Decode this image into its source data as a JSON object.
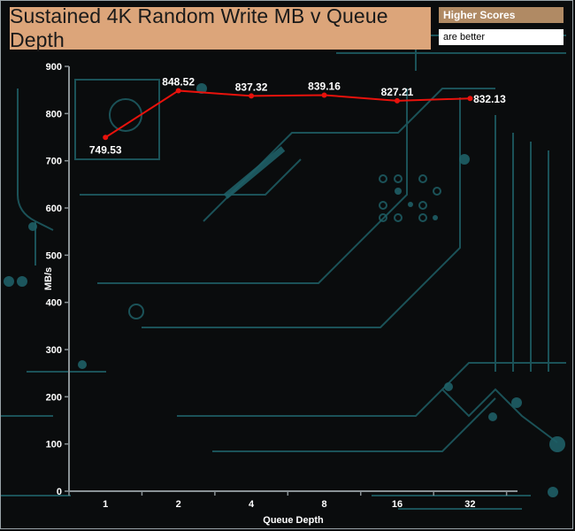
{
  "title": "Sustained 4K Random Write MB v Queue Depth",
  "legend": {
    "line1": "Higher Scores",
    "line2": "are better"
  },
  "colors": {
    "title_bg": "#dca57a",
    "series_line": "#e8120c",
    "circuit": "#1e5f66"
  },
  "chart_data": {
    "type": "line",
    "title": "Sustained 4K Random Write MB v Queue Depth",
    "xlabel": "Queue Depth",
    "ylabel": "MB/s",
    "categories": [
      "1",
      "2",
      "4",
      "8",
      "16",
      "32"
    ],
    "yticks": [
      0,
      100,
      200,
      300,
      400,
      500,
      600,
      700,
      800,
      900
    ],
    "ylim": [
      0,
      900
    ],
    "series": [
      {
        "values": [
          749.53,
          848.52,
          837.32,
          839.16,
          827.21,
          832.13
        ],
        "labels": [
          "749.53",
          "848.52",
          "837.32",
          "839.16",
          "827.21",
          "832.13"
        ]
      }
    ],
    "grid": false,
    "legend_position": "top-right"
  }
}
